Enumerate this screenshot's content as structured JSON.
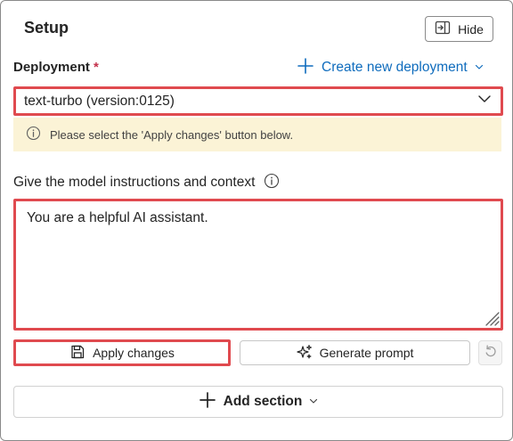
{
  "panel": {
    "title": "Setup",
    "hide_label": "Hide"
  },
  "deployment": {
    "label": "Deployment",
    "required_marker": "*",
    "create_link": "Create new deployment",
    "selected": "text-turbo (version:0125)",
    "notice": "Please select the 'Apply changes' button below."
  },
  "instructions": {
    "label": "Give the model instructions and context",
    "value": "You are a helpful AI assistant."
  },
  "actions": {
    "apply_label": "Apply changes",
    "generate_label": "Generate prompt",
    "add_section_label": "Add section"
  },
  "icons": {
    "hide": "panel-collapse-icon",
    "create": "plus-icon",
    "select": "chevron-down-icon",
    "notice": "info-icon",
    "apply": "save-icon",
    "generate": "sparkle-icon",
    "undo": "undo-icon",
    "add_section": "plus-icon"
  },
  "colors": {
    "accent": "#0f6cbd",
    "highlight": "#e04a4f",
    "notice_bg": "#fbf3d6",
    "required": "#c4314b"
  }
}
